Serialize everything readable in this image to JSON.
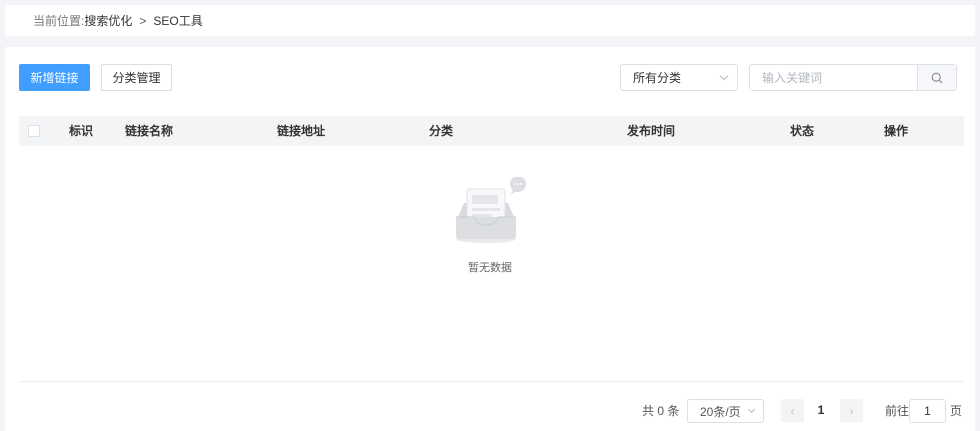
{
  "breadcrumb": {
    "prefix": "当前位置:",
    "parent": "搜索优化",
    "separator": ">",
    "current": "SEO工具"
  },
  "toolbar": {
    "add_label": "新增链接",
    "category_manage_label": "分类管理",
    "category_select": {
      "selected": "所有分类"
    },
    "search": {
      "placeholder": "输入关键词"
    }
  },
  "table": {
    "columns": [
      "标识",
      "链接名称",
      "链接地址",
      "分类",
      "发布时间",
      "状态",
      "操作"
    ],
    "rows": [],
    "empty_text": "暂无数据"
  },
  "pagination": {
    "total_text": "共 0 条",
    "page_size": "20条/页",
    "current_page": "1",
    "goto_prefix": "前往",
    "goto_value": "1",
    "goto_suffix": "页"
  },
  "colors": {
    "primary": "#409eff",
    "page_background": "#f3f4f7",
    "header_background": "#f3f4f6"
  }
}
